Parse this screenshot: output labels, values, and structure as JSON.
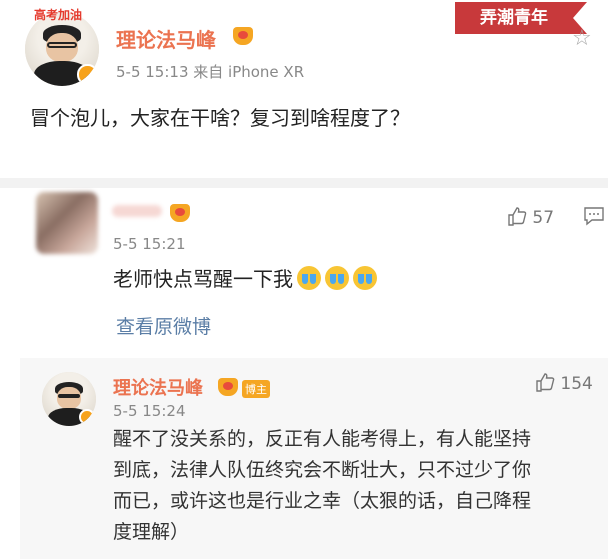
{
  "watermark": "弄潮青年",
  "post": {
    "avatar_brush": "高考加油",
    "author": "理论法马峰",
    "meta": "5-5 15:13  来自 iPhone XR",
    "content": "冒个泡儿，大家在干啥？复习到啥程度了？"
  },
  "comment": {
    "time": "5-5 15:21",
    "likes": "57",
    "content": "老师快点骂醒一下我",
    "emoji_count": 3,
    "view_original": "查看原微博"
  },
  "reply": {
    "author": "理论法马峰",
    "badge": "博主",
    "time": "5-5 15:24",
    "likes": "154",
    "lines": [
      "醒不了没关系的，反正有人能考得上，有人能坚持",
      "到底，法律人队伍终究会不断壮大，只不过少了你",
      "而已，或许这也是行业之幸（太狠的话，自己降程",
      "度理解）"
    ]
  },
  "colors": {
    "name": "#eb7350",
    "link": "#5b7ea6",
    "watermark": "#c8393b"
  },
  "icons": [
    "verified-icon",
    "crown-icon",
    "star-icon",
    "thumb-up-icon",
    "comment-icon",
    "crying-emoji-icon"
  ]
}
